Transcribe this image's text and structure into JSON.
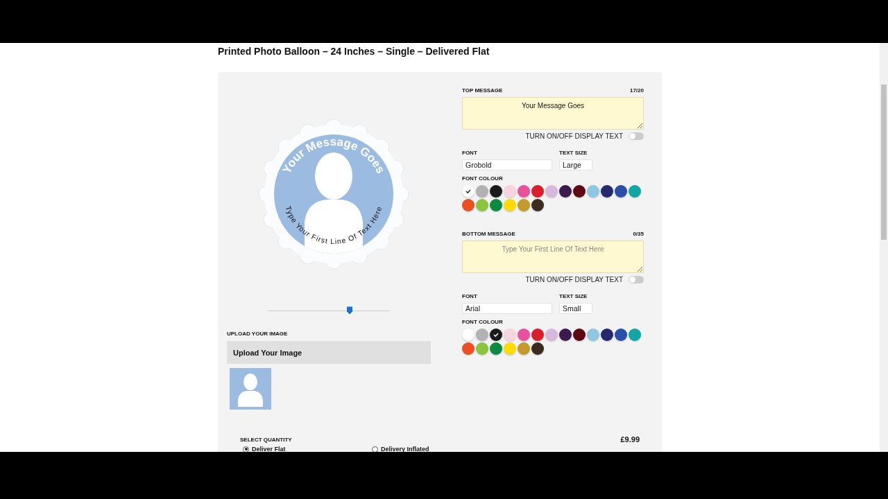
{
  "title": "Printed Photo Balloon – 24 Inches – Single – Delivered Flat",
  "preview": {
    "top_text": "Your Message Goes",
    "bottom_text": "Type Your First Line Of Text Here",
    "zoom": {
      "level": 0.67
    }
  },
  "upload": {
    "label": "UPLOAD YOUR IMAGE",
    "button": "Upload Your Image"
  },
  "messages": [
    {
      "label": "TOP MESSAGE",
      "count": "17/20",
      "value": "Your Message Goes",
      "toggle_label": "TURN ON/OFF DISPLAY TEXT",
      "toggle_on": false,
      "font_label": "FONT",
      "font": "Grobold",
      "size_label": "TEXT SIZE",
      "size": "Large",
      "colour_label": "FONT COLOUR",
      "colours": [
        {
          "color": "#ffffff",
          "selected": true
        },
        {
          "color": "#b3b1b4",
          "selected": false
        },
        {
          "color": "#1a1a1a",
          "selected": false
        },
        {
          "color": "#f9d3e0",
          "selected": false
        },
        {
          "color": "#e9519f",
          "selected": false
        },
        {
          "color": "#d81f2a",
          "selected": false
        },
        {
          "color": "#d6b9dc",
          "selected": false
        },
        {
          "color": "#3d1a4e",
          "selected": false
        },
        {
          "color": "#5e0a14",
          "selected": false
        },
        {
          "color": "#8fc7e3",
          "selected": false
        },
        {
          "color": "#27296d",
          "selected": false
        },
        {
          "color": "#2a4fa8",
          "selected": false
        },
        {
          "color": "#12a5a5",
          "selected": false
        },
        {
          "color": "#ec5021",
          "selected": false
        },
        {
          "color": "#8bc53f",
          "selected": false
        },
        {
          "color": "#0b8a43",
          "selected": false
        },
        {
          "color": "#fddc03",
          "selected": false
        },
        {
          "color": "#c49a2c",
          "selected": false
        },
        {
          "color": "#3d2b20",
          "selected": false
        }
      ]
    },
    {
      "label": "BOTTOM MESSAGE",
      "count": "0/35",
      "placeholder": "Type Your First Line Of Text Here",
      "toggle_label": "TURN ON/OFF DISPLAY TEXT",
      "toggle_on": false,
      "font_label": "FONT",
      "font": "Arial",
      "size_label": "TEXT SIZE",
      "size": "Small",
      "colour_label": "FONT COLOUR",
      "colours": [
        {
          "color": "#ffffff",
          "selected": false
        },
        {
          "color": "#b3b1b4",
          "selected": false
        },
        {
          "color": "#1a1a1a",
          "selected": true
        },
        {
          "color": "#f9d3e0",
          "selected": false
        },
        {
          "color": "#e9519f",
          "selected": false
        },
        {
          "color": "#d81f2a",
          "selected": false
        },
        {
          "color": "#d6b9dc",
          "selected": false
        },
        {
          "color": "#3d1a4e",
          "selected": false
        },
        {
          "color": "#5e0a14",
          "selected": false
        },
        {
          "color": "#8fc7e3",
          "selected": false
        },
        {
          "color": "#27296d",
          "selected": false
        },
        {
          "color": "#2a4fa8",
          "selected": false
        },
        {
          "color": "#12a5a5",
          "selected": false
        },
        {
          "color": "#ec5021",
          "selected": false
        },
        {
          "color": "#8bc53f",
          "selected": false
        },
        {
          "color": "#0b8a43",
          "selected": false
        },
        {
          "color": "#fddc03",
          "selected": false
        },
        {
          "color": "#c49a2c",
          "selected": false
        },
        {
          "color": "#3d2b20",
          "selected": false
        }
      ]
    }
  ],
  "quantity": {
    "label": "SELECT QUANTITY",
    "price": "£9.99",
    "options": [
      {
        "label": "Deliver Flat",
        "selected": true
      },
      {
        "label": "Delivery Inflated",
        "selected": false
      }
    ]
  }
}
